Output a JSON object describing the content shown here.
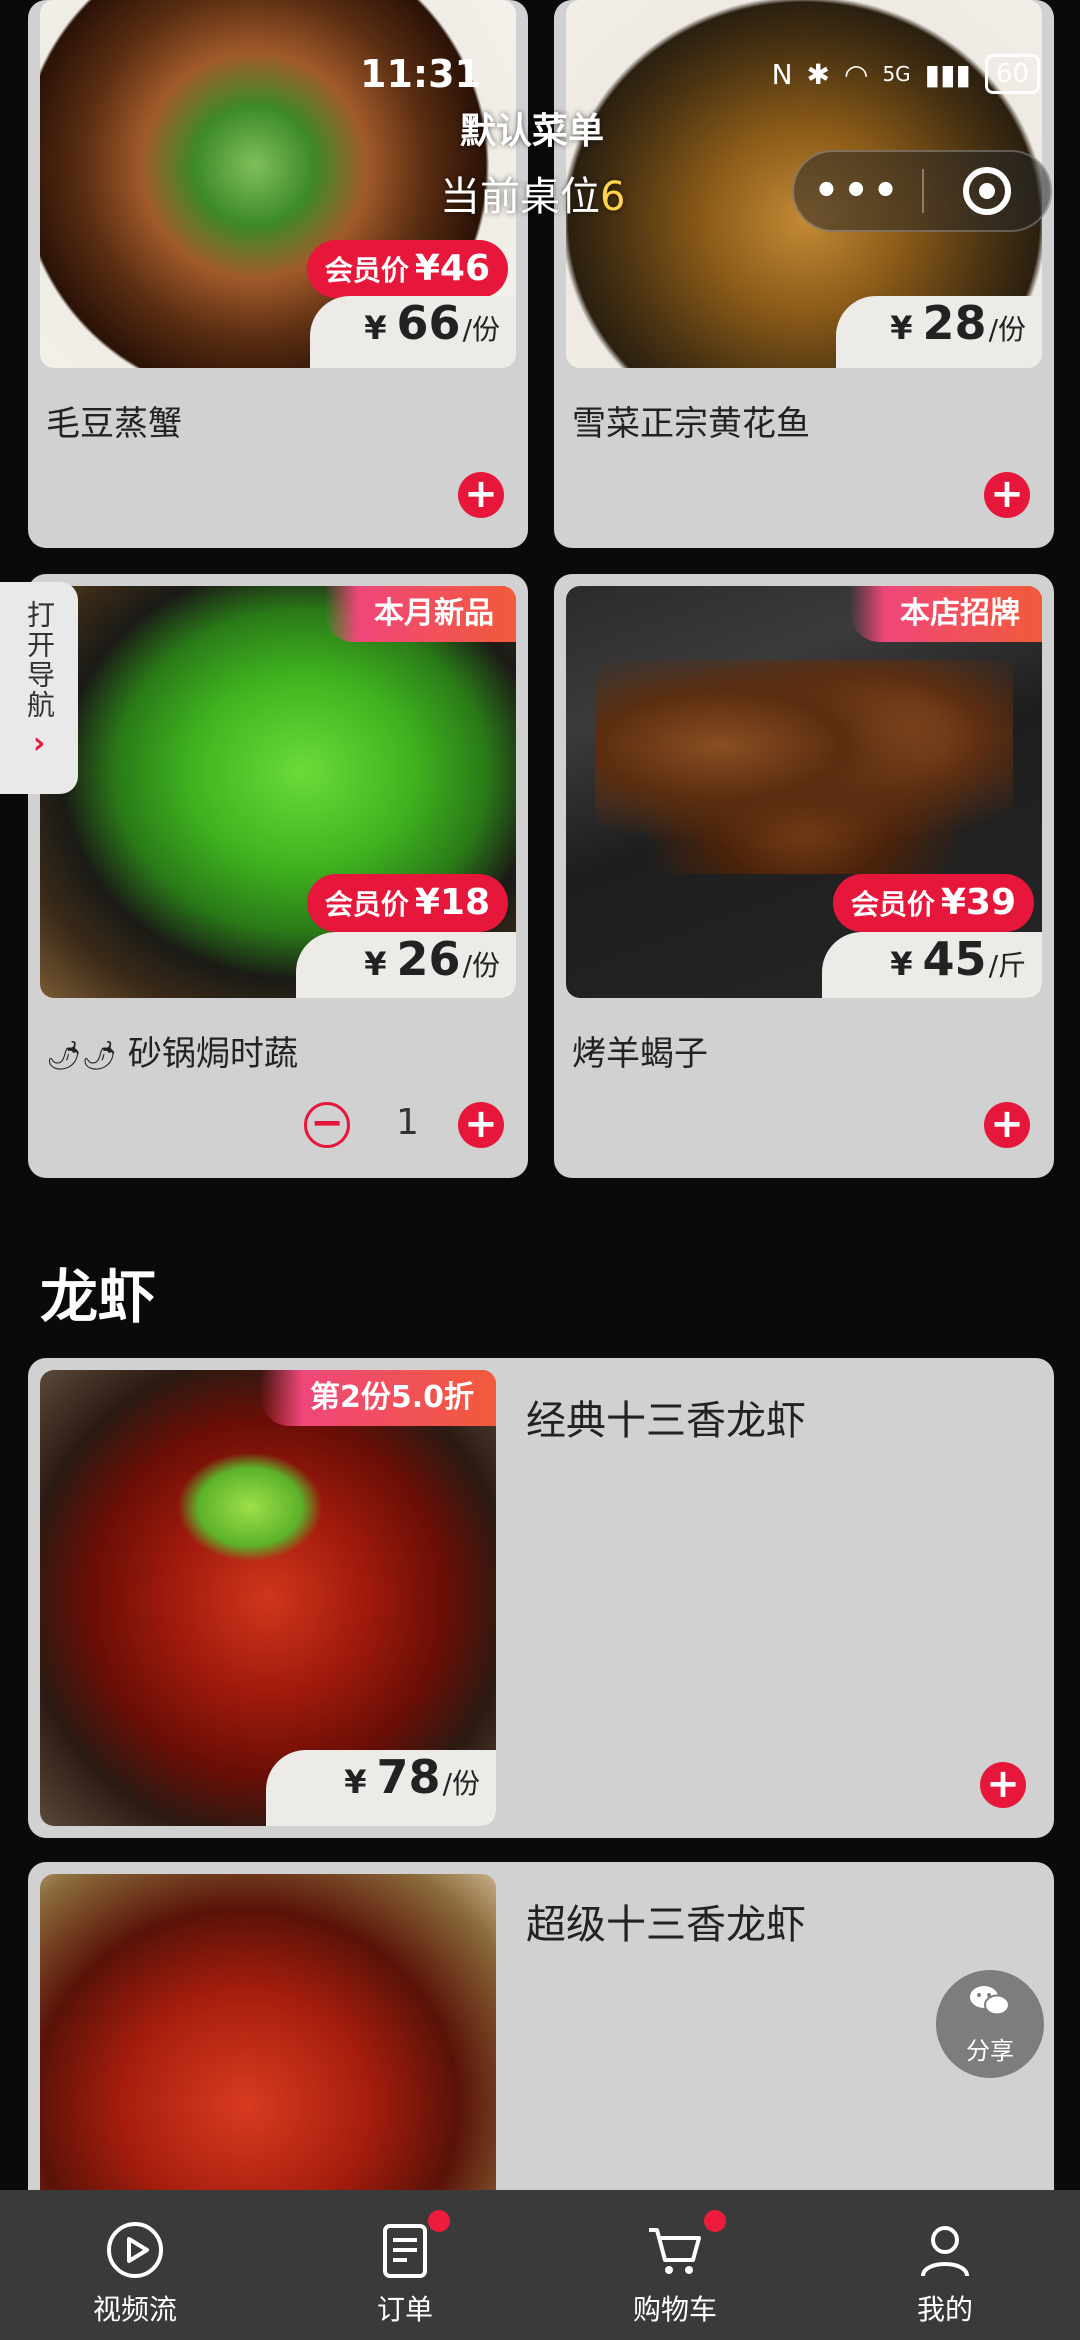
{
  "status": {
    "time": "11:31",
    "network": "5G",
    "battery": "60"
  },
  "header": {
    "menu_title": "默认菜单",
    "table_label": "当前桌位",
    "table_number": "6"
  },
  "side_nav": {
    "label": "打开导航",
    "chevron": "›"
  },
  "dishes": [
    {
      "name": "毛豆蒸蟹",
      "price": "66",
      "unit": "/份",
      "currency": "¥",
      "member_label": "会员价",
      "member_price": "¥46"
    },
    {
      "name": "雪菜正宗黄花鱼",
      "price": "28",
      "unit": "/份",
      "currency": "¥"
    },
    {
      "name": "砂锅焗时蔬",
      "spicy": "🌶🌶",
      "price": "26",
      "unit": "/份",
      "currency": "¥",
      "member_label": "会员价",
      "member_price": "¥18",
      "badge": "本月新品",
      "quantity": "1"
    },
    {
      "name": "烤羊蝎子",
      "price": "45",
      "unit": "/斤",
      "currency": "¥",
      "member_label": "会员价",
      "member_price": "¥39",
      "badge": "本店招牌"
    }
  ],
  "section": {
    "title": "龙虾"
  },
  "lobsters": [
    {
      "name": "经典十三香龙虾",
      "price": "78",
      "unit": "/份",
      "currency": "¥",
      "badge": "第2份5.0折"
    },
    {
      "name": "超级十三香龙虾"
    }
  ],
  "buttons": {
    "plus": "+",
    "minus": "−"
  },
  "share": {
    "label": "分享"
  },
  "tabbar": {
    "items": [
      {
        "label": "视频流",
        "icon": "play-circle-icon"
      },
      {
        "label": "订单",
        "icon": "order-icon",
        "has_dot": true
      },
      {
        "label": "购物车",
        "icon": "cart-icon",
        "has_dot": true
      },
      {
        "label": "我的",
        "icon": "user-icon"
      }
    ]
  },
  "colors": {
    "accent": "#e6173a",
    "card_bg": "#d1d1d1",
    "tabbar_bg": "#3a3a3a",
    "page_bg": "#0a0a0a"
  }
}
